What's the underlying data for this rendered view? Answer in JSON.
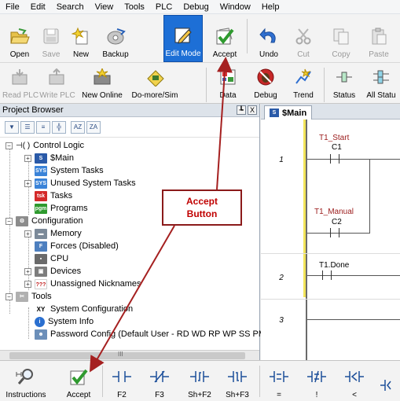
{
  "menu": [
    "File",
    "Edit",
    "Search",
    "View",
    "Tools",
    "PLC",
    "Debug",
    "Window",
    "Help"
  ],
  "toolbar1": {
    "open": "Open",
    "save": "Save",
    "new": "New",
    "backup": "Backup",
    "edit_mode": "Edit Mode",
    "accept": "Accept",
    "undo": "Undo",
    "cut": "Cut",
    "copy": "Copy",
    "paste": "Paste"
  },
  "toolbar2": {
    "read_plc": "Read PLC",
    "write_plc": "Write PLC",
    "new_online": "New Online",
    "domore_sim": "Do-more/Sim",
    "data": "Data",
    "debug": "Debug",
    "trend": "Trend",
    "status": "Status",
    "all_status": "All Statu"
  },
  "project_browser": {
    "title": "Project Browser",
    "pin": "┺",
    "close": "X",
    "tree": {
      "control_logic": "Control Logic",
      "main": "$Main",
      "system_tasks": "System Tasks",
      "unused_system_tasks": "Unused System Tasks",
      "tasks": "Tasks",
      "programs": "Programs",
      "configuration": "Configuration",
      "memory": "Memory",
      "forces": "Forces (Disabled)",
      "cpu": "CPU",
      "devices": "Devices",
      "unassigned_nicknames": "Unassigned Nicknames",
      "tools": "Tools",
      "system_configuration": "System Configuration",
      "system_info": "System Info",
      "password_config": "Password Config (Default User - RD WD RP WP SS PM"
    },
    "scroll_mark": "III"
  },
  "editor": {
    "tab": "$Main",
    "rungs": [
      {
        "number": "1"
      },
      {
        "number": "2"
      },
      {
        "number": "3"
      }
    ],
    "contacts": [
      {
        "nickname": "T1_Start",
        "address": "C1"
      },
      {
        "nickname": "T1_Manual",
        "address": "C2"
      },
      {
        "nickname": "",
        "address": "T1.Done"
      }
    ]
  },
  "bottom_toolbar": {
    "instructions": "Instructions",
    "accept": "Accept",
    "f2": "F2",
    "f3": "F3",
    "shf2": "Sh+F2",
    "shf3": "Sh+F3",
    "eq": "=",
    "neq": "!",
    "lt": "<"
  },
  "callout": {
    "line1": "Accept",
    "line2": "Button"
  },
  "colors": {
    "callout": "#c00000",
    "arrow": "#a52020",
    "edit_mode_bg": "#1d6fd6",
    "nickname": "#9b1b1b"
  }
}
